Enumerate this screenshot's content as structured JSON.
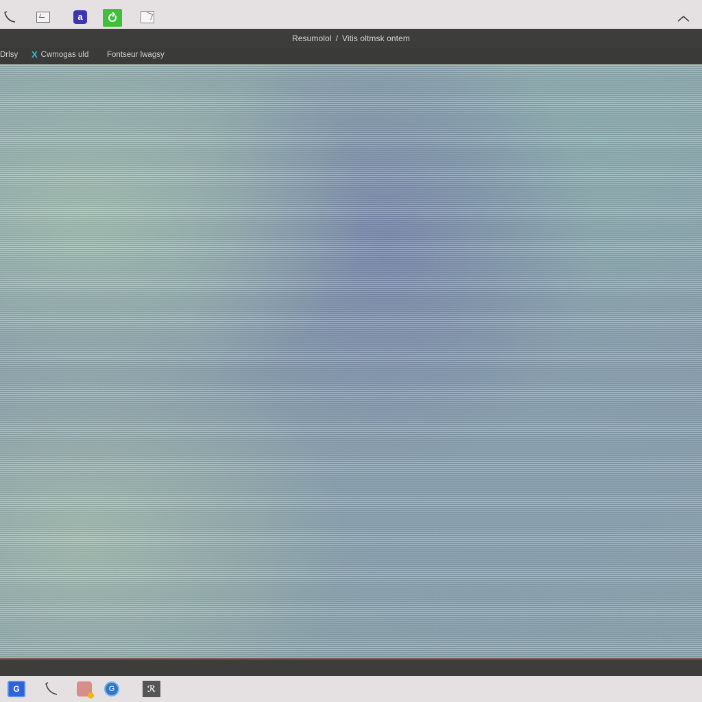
{
  "top_icons": [
    {
      "name": "phone-icon"
    },
    {
      "name": "mail-icon"
    },
    {
      "name": "app-icon",
      "glyph": "a"
    },
    {
      "name": "refresh-icon"
    },
    {
      "name": "note-icon"
    },
    {
      "name": "collapse-icon"
    }
  ],
  "title": {
    "left": "Resumolol",
    "sep": "/",
    "right": "Vitis  oltmsk ontem"
  },
  "nav": {
    "item1": "Drlsy",
    "item2": "Cwmogas uld",
    "item3": "Fontseur lwagsy"
  },
  "colors": {
    "dark_bar": "#3d3e3c",
    "light_bar": "#e5e1e2",
    "accent_green": "#3fbf3a",
    "accent_blue": "#3b36b0",
    "nav_x": "#2fc4d8"
  },
  "taskbar": [
    {
      "name": "monitor-icon",
      "glyph": "G"
    },
    {
      "name": "phone-icon"
    },
    {
      "name": "photos-icon"
    },
    {
      "name": "globe-icon",
      "glyph": "G"
    },
    {
      "name": "terminal-icon",
      "glyph": "ℛ"
    }
  ]
}
